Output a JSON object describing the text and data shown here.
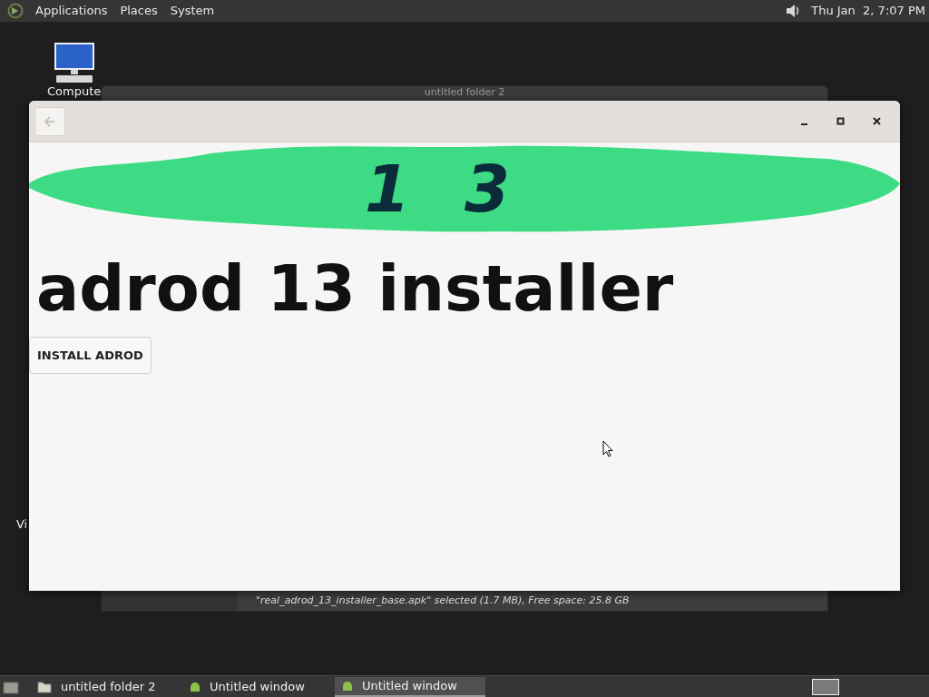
{
  "top_panel": {
    "menus": [
      {
        "label": "Applications"
      },
      {
        "label": "Places"
      },
      {
        "label": "System"
      }
    ],
    "clock": "Thu Jan  2, 7:07 PM"
  },
  "desktop_icons": [
    {
      "label": "Compute",
      "kind": "computer"
    },
    {
      "label": "Vi",
      "kind": "plain"
    }
  ],
  "back_window": {
    "title": "untitled folder 2",
    "status": "\"real_adrod_13_installer_base.apk\" selected (1.7 MB), Free space: 25.8 GB"
  },
  "app_window": {
    "banner_text": "13",
    "heading": "adrod 13 installer",
    "button": "INSTALL ADROD"
  },
  "taskbar": {
    "items": [
      {
        "label": "untitled folder 2",
        "kind": "folder",
        "selected": false
      },
      {
        "label": "Untitled window",
        "kind": "app",
        "selected": false
      },
      {
        "label": "Untitled window",
        "kind": "app",
        "selected": true
      }
    ]
  }
}
